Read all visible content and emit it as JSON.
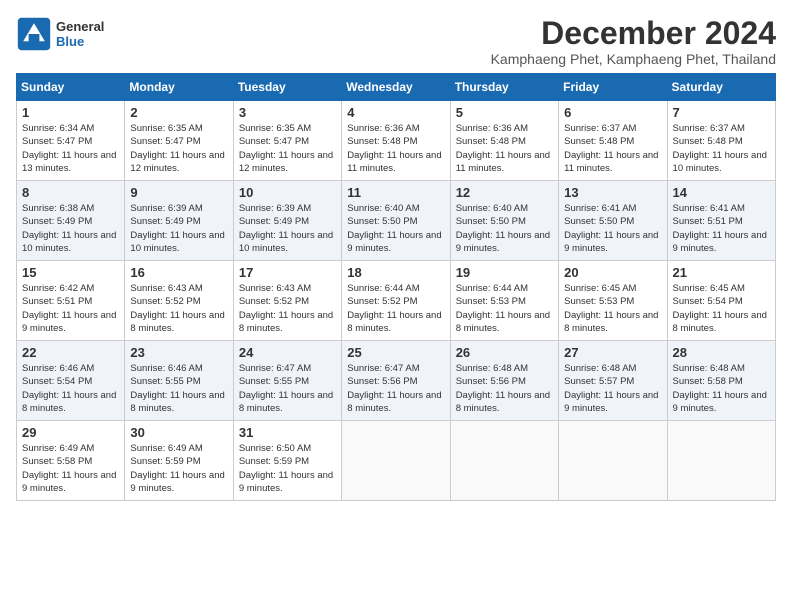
{
  "logo": {
    "line1": "General",
    "line2": "Blue"
  },
  "title": "December 2024",
  "location": "Kamphaeng Phet, Kamphaeng Phet, Thailand",
  "days_of_week": [
    "Sunday",
    "Monday",
    "Tuesday",
    "Wednesday",
    "Thursday",
    "Friday",
    "Saturday"
  ],
  "weeks": [
    [
      {
        "day": "1",
        "sunrise": "6:34 AM",
        "sunset": "5:47 PM",
        "daylight": "11 hours and 13 minutes."
      },
      {
        "day": "2",
        "sunrise": "6:35 AM",
        "sunset": "5:47 PM",
        "daylight": "11 hours and 12 minutes."
      },
      {
        "day": "3",
        "sunrise": "6:35 AM",
        "sunset": "5:47 PM",
        "daylight": "11 hours and 12 minutes."
      },
      {
        "day": "4",
        "sunrise": "6:36 AM",
        "sunset": "5:48 PM",
        "daylight": "11 hours and 11 minutes."
      },
      {
        "day": "5",
        "sunrise": "6:36 AM",
        "sunset": "5:48 PM",
        "daylight": "11 hours and 11 minutes."
      },
      {
        "day": "6",
        "sunrise": "6:37 AM",
        "sunset": "5:48 PM",
        "daylight": "11 hours and 11 minutes."
      },
      {
        "day": "7",
        "sunrise": "6:37 AM",
        "sunset": "5:48 PM",
        "daylight": "11 hours and 10 minutes."
      }
    ],
    [
      {
        "day": "8",
        "sunrise": "6:38 AM",
        "sunset": "5:49 PM",
        "daylight": "11 hours and 10 minutes."
      },
      {
        "day": "9",
        "sunrise": "6:39 AM",
        "sunset": "5:49 PM",
        "daylight": "11 hours and 10 minutes."
      },
      {
        "day": "10",
        "sunrise": "6:39 AM",
        "sunset": "5:49 PM",
        "daylight": "11 hours and 10 minutes."
      },
      {
        "day": "11",
        "sunrise": "6:40 AM",
        "sunset": "5:50 PM",
        "daylight": "11 hours and 9 minutes."
      },
      {
        "day": "12",
        "sunrise": "6:40 AM",
        "sunset": "5:50 PM",
        "daylight": "11 hours and 9 minutes."
      },
      {
        "day": "13",
        "sunrise": "6:41 AM",
        "sunset": "5:50 PM",
        "daylight": "11 hours and 9 minutes."
      },
      {
        "day": "14",
        "sunrise": "6:41 AM",
        "sunset": "5:51 PM",
        "daylight": "11 hours and 9 minutes."
      }
    ],
    [
      {
        "day": "15",
        "sunrise": "6:42 AM",
        "sunset": "5:51 PM",
        "daylight": "11 hours and 9 minutes."
      },
      {
        "day": "16",
        "sunrise": "6:43 AM",
        "sunset": "5:52 PM",
        "daylight": "11 hours and 8 minutes."
      },
      {
        "day": "17",
        "sunrise": "6:43 AM",
        "sunset": "5:52 PM",
        "daylight": "11 hours and 8 minutes."
      },
      {
        "day": "18",
        "sunrise": "6:44 AM",
        "sunset": "5:52 PM",
        "daylight": "11 hours and 8 minutes."
      },
      {
        "day": "19",
        "sunrise": "6:44 AM",
        "sunset": "5:53 PM",
        "daylight": "11 hours and 8 minutes."
      },
      {
        "day": "20",
        "sunrise": "6:45 AM",
        "sunset": "5:53 PM",
        "daylight": "11 hours and 8 minutes."
      },
      {
        "day": "21",
        "sunrise": "6:45 AM",
        "sunset": "5:54 PM",
        "daylight": "11 hours and 8 minutes."
      }
    ],
    [
      {
        "day": "22",
        "sunrise": "6:46 AM",
        "sunset": "5:54 PM",
        "daylight": "11 hours and 8 minutes."
      },
      {
        "day": "23",
        "sunrise": "6:46 AM",
        "sunset": "5:55 PM",
        "daylight": "11 hours and 8 minutes."
      },
      {
        "day": "24",
        "sunrise": "6:47 AM",
        "sunset": "5:55 PM",
        "daylight": "11 hours and 8 minutes."
      },
      {
        "day": "25",
        "sunrise": "6:47 AM",
        "sunset": "5:56 PM",
        "daylight": "11 hours and 8 minutes."
      },
      {
        "day": "26",
        "sunrise": "6:48 AM",
        "sunset": "5:56 PM",
        "daylight": "11 hours and 8 minutes."
      },
      {
        "day": "27",
        "sunrise": "6:48 AM",
        "sunset": "5:57 PM",
        "daylight": "11 hours and 9 minutes."
      },
      {
        "day": "28",
        "sunrise": "6:48 AM",
        "sunset": "5:58 PM",
        "daylight": "11 hours and 9 minutes."
      }
    ],
    [
      {
        "day": "29",
        "sunrise": "6:49 AM",
        "sunset": "5:58 PM",
        "daylight": "11 hours and 9 minutes."
      },
      {
        "day": "30",
        "sunrise": "6:49 AM",
        "sunset": "5:59 PM",
        "daylight": "11 hours and 9 minutes."
      },
      {
        "day": "31",
        "sunrise": "6:50 AM",
        "sunset": "5:59 PM",
        "daylight": "11 hours and 9 minutes."
      },
      null,
      null,
      null,
      null
    ]
  ]
}
